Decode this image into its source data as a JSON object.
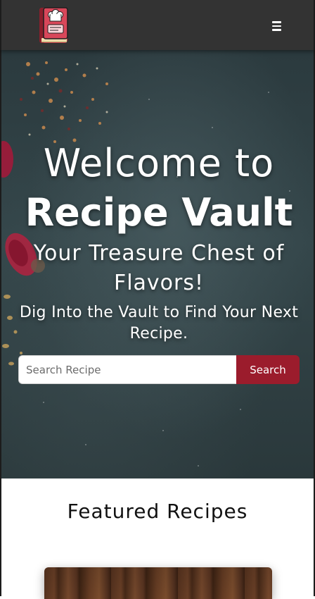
{
  "navbar": {
    "logo_icon": "chef-recipe-book-icon",
    "menu_icon": "hamburger-menu-icon"
  },
  "hero": {
    "welcome": "Welcome to",
    "brand": "Recipe Vault",
    "tagline": "Your Treasure Chest of Flavors!",
    "subtitle": "Dig Into the Vault to Find Your Next Recipe."
  },
  "search": {
    "placeholder": "Search Recipe",
    "value": "",
    "button_label": "Search"
  },
  "featured": {
    "title": "Featured Recipes"
  },
  "colors": {
    "navbar_bg": "#333333",
    "accent": "#9b1c2c",
    "hero_bg": "#2f3f43"
  }
}
